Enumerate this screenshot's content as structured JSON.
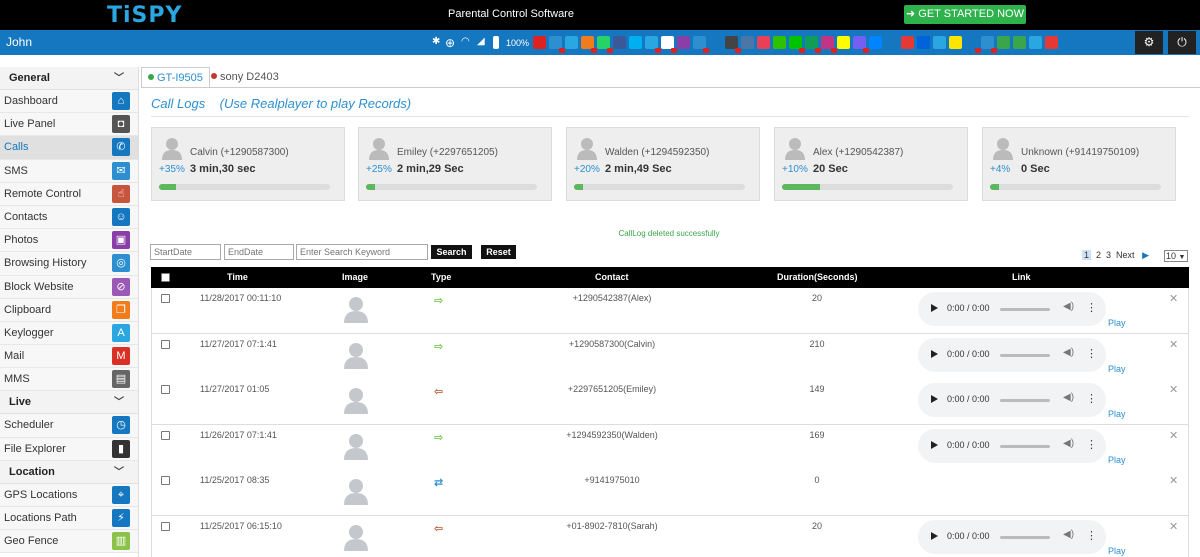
{
  "header": {
    "logo": "TiSPY",
    "tagline": "Parental Control Software",
    "cta_label": "GET STARTED NOW"
  },
  "navbar": {
    "user": "John",
    "battery": "100%"
  },
  "sidebar": {
    "groups": [
      {
        "title": "General",
        "items": [
          {
            "label": "Dashboard",
            "icon": "home-icon",
            "color": "#1577bf"
          },
          {
            "label": "Live Panel",
            "icon": "camera-icon",
            "color": "#555555"
          },
          {
            "label": "Calls",
            "icon": "phone-icon",
            "color": "#1577bf",
            "active": true
          },
          {
            "label": "SMS",
            "icon": "envelope-icon",
            "color": "#2d8fd0"
          },
          {
            "label": "Remote Control",
            "icon": "remote-icon",
            "color": "#c8553d"
          },
          {
            "label": "Contacts",
            "icon": "contact-card-icon",
            "color": "#1577bf"
          },
          {
            "label": "Photos",
            "icon": "photo-icon",
            "color": "#8a3ea8"
          },
          {
            "label": "Browsing History",
            "icon": "globe-icon",
            "color": "#2d8fd0"
          },
          {
            "label": "Block Website",
            "icon": "blocked-globe-icon",
            "color": "#9b59b6"
          },
          {
            "label": "Clipboard",
            "icon": "clipboard-icon",
            "color": "#f07c1b"
          },
          {
            "label": "Keylogger",
            "icon": "keyboard-app-icon",
            "color": "#2aa6e0"
          },
          {
            "label": "Mail",
            "icon": "gmail-icon",
            "color": "#d93025"
          },
          {
            "label": "MMS",
            "icon": "mms-icon",
            "color": "#666666"
          }
        ]
      },
      {
        "title": "Live",
        "items": [
          {
            "label": "Scheduler",
            "icon": "clock-icon",
            "color": "#1577bf"
          },
          {
            "label": "File Explorer",
            "icon": "sdcard-icon",
            "color": "#333333"
          }
        ]
      },
      {
        "title": "Location",
        "items": [
          {
            "label": "GPS Locations",
            "icon": "map-pin-icon",
            "color": "#1577bf"
          },
          {
            "label": "Locations Path",
            "icon": "path-icon",
            "color": "#1577bf"
          },
          {
            "label": "Geo Fence",
            "icon": "fence-icon",
            "color": "#8bc34a"
          }
        ]
      }
    ]
  },
  "devices": [
    {
      "label": "GT-I9505",
      "status_color": "#3aa64c",
      "active": true
    },
    {
      "label": "sony D2403",
      "status_color": "#c0392b",
      "active": false
    }
  ],
  "page": {
    "title": "Call Logs",
    "subtitle": "(Use Realplayer to play Records)",
    "message": "CallLog deleted successfully"
  },
  "cards": [
    {
      "name": "Calvin (+1290587300)",
      "percent": "+35%",
      "duration": "3 min,30 sec",
      "fill": 0.1
    },
    {
      "name": "Emiley (+2297651205)",
      "percent": "+25%",
      "duration": "2 min,29 Sec",
      "fill": 0.05
    },
    {
      "name": "Walden (+1294592350)",
      "percent": "+20%",
      "duration": "2 min,49 Sec",
      "fill": 0.05
    },
    {
      "name": "Alex (+1290542387)",
      "percent": "+10%",
      "duration": "20 Sec",
      "fill": 0.22
    },
    {
      "name": "Unknown (+91419750109)",
      "percent": "+4%",
      "duration": "0 Sec",
      "fill": 0.05
    }
  ],
  "filters": {
    "start_placeholder": "StartDate",
    "end_placeholder": "EndDate",
    "search_placeholder": "Enter Search Keyword",
    "search_label": "Search",
    "reset_label": "Reset"
  },
  "pagination": {
    "pages": [
      "1",
      "2",
      "3"
    ],
    "next_label": "Next",
    "per_page": "10"
  },
  "table": {
    "columns": [
      "Time",
      "Image",
      "Type",
      "Contact",
      "Duration(Seconds)",
      "Link"
    ],
    "play_label": "Play",
    "player_time": "0:00 / 0:00",
    "rows": [
      {
        "time": "11/28/2017 00:11:10",
        "type": "outgoing",
        "contact": "+1290542387(Alex)",
        "duration": "20",
        "has_audio": true
      },
      {
        "time": "11/27/2017 07:1:41",
        "type": "outgoing",
        "contact": "+1290587300(Calvin)",
        "duration": "210",
        "has_audio": true
      },
      {
        "time": "11/27/2017 01:05",
        "type": "incoming",
        "contact": "+2297651205(Emiley)",
        "duration": "149",
        "has_audio": true
      },
      {
        "time": "11/26/2017 07:1:41",
        "type": "outgoing",
        "contact": "+1294592350(Walden)",
        "duration": "169",
        "has_audio": true
      },
      {
        "time": "11/25/2017 08:35",
        "type": "missed",
        "contact": "+9141975010",
        "duration": "0",
        "has_audio": false
      },
      {
        "time": "11/25/2017 06:15:10",
        "type": "incoming",
        "contact": "+01-8902-7810(Sarah)",
        "duration": "20",
        "has_audio": true
      }
    ]
  }
}
